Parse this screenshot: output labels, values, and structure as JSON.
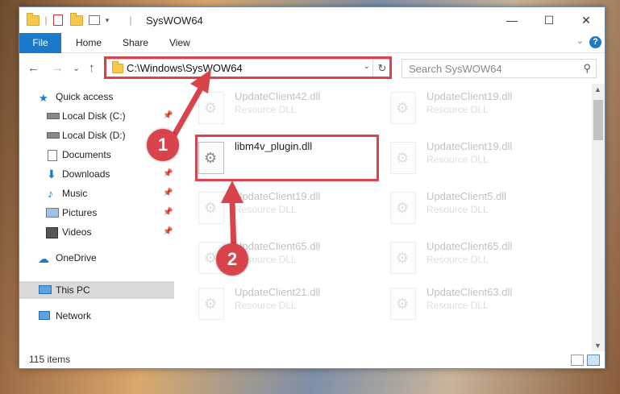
{
  "window": {
    "title": "SysWOW64"
  },
  "window_buttons": {
    "minimize": "—",
    "maximize": "☐",
    "close": "✕"
  },
  "ribbon": {
    "tabs": [
      "File",
      "Home",
      "Share",
      "View"
    ],
    "help": "?",
    "collapse": "⌄"
  },
  "nav": {
    "back": "←",
    "forward": "→",
    "recent": "⌄",
    "up": "↑",
    "refresh": "↻",
    "dropdown": "⌄"
  },
  "address": {
    "path": "C:\\Windows\\SysWOW64"
  },
  "search": {
    "placeholder": "Search SysWOW64",
    "icon": "⚲"
  },
  "sidebar": {
    "items": [
      {
        "label": "Quick access",
        "icon": "star-icon",
        "pinned": false
      },
      {
        "label": "Local Disk (C:)",
        "icon": "drive-icon",
        "pinned": true
      },
      {
        "label": "Local Disk (D:)",
        "icon": "drive-icon",
        "pinned": false
      },
      {
        "label": "Documents",
        "icon": "documents-icon",
        "pinned": true
      },
      {
        "label": "Downloads",
        "icon": "download-icon",
        "pinned": true
      },
      {
        "label": "Music",
        "icon": "music-icon",
        "pinned": true
      },
      {
        "label": "Pictures",
        "icon": "pictures-icon",
        "pinned": true
      },
      {
        "label": "Videos",
        "icon": "videos-icon",
        "pinned": true
      },
      {
        "label": "OneDrive",
        "icon": "cloud-icon",
        "pinned": false
      },
      {
        "label": "This PC",
        "icon": "computer-icon",
        "pinned": false,
        "selected": true
      },
      {
        "label": "Network",
        "icon": "network-icon",
        "pinned": false
      }
    ],
    "pin_glyph": "📌"
  },
  "files": [
    {
      "name": "UpdateClient42.dll",
      "type": "Resource DLL",
      "faded": true
    },
    {
      "name": "UpdateClient19.dll",
      "type": "Resource DLL",
      "faded": true
    },
    {
      "name": "libm4v_plugin.dll",
      "type": "",
      "faded": false
    },
    {
      "name": "UpdateClient19.dll",
      "type": "Resource DLL",
      "faded": true
    },
    {
      "name": "UpdateClient19.dll",
      "type": "Resource DLL",
      "faded": true
    },
    {
      "name": "UpdateClient5.dll",
      "type": "Resource DLL",
      "faded": true
    },
    {
      "name": "UpdateClient65.dll",
      "type": "Resource DLL",
      "faded": true
    },
    {
      "name": "UpdateClient65.dll",
      "type": "Resource DLL",
      "faded": true
    },
    {
      "name": "UpdateClient21.dll",
      "type": "Resource DLL",
      "faded": true
    },
    {
      "name": "UpdateClient63.dll",
      "type": "Resource DLL",
      "faded": true
    }
  ],
  "status": {
    "count": "115 items"
  },
  "annotations": {
    "step1": "1",
    "step2": "2"
  },
  "colors": {
    "accent": "#1979ca",
    "highlight": "#d9434b",
    "selected": "#d9d9d9"
  }
}
